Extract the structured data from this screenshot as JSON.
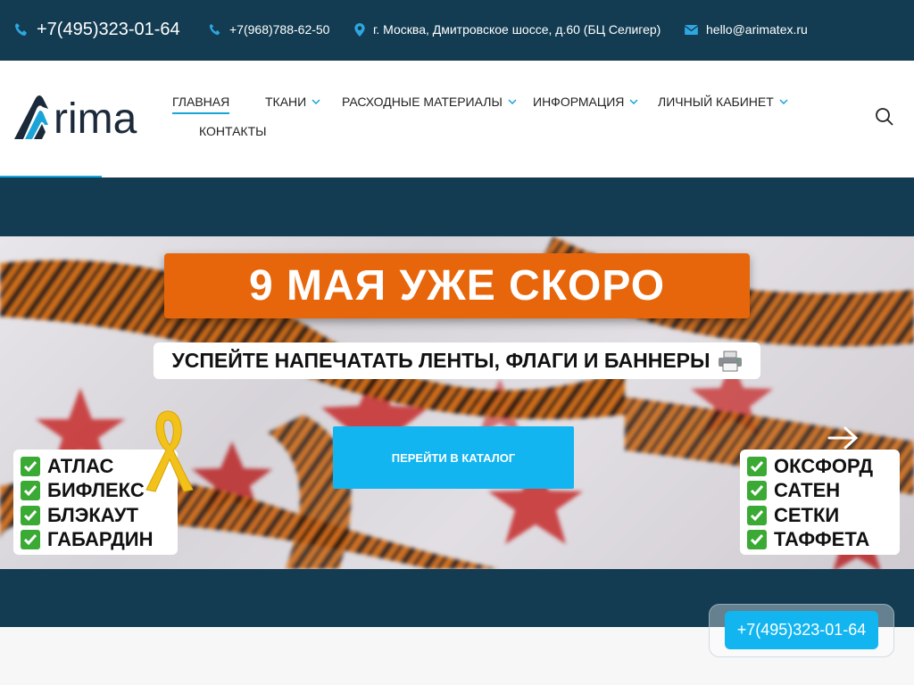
{
  "topbar": {
    "main_phone": "+7(495)323-01-64",
    "phone2": "+7(968)788-62-50",
    "address": "г. Москва, Дмитровское шоссе, д.60 (БЦ Селигер)",
    "email": "hello@arimatex.ru"
  },
  "logo": {
    "text": "rima"
  },
  "nav": {
    "home": "ГЛАВНАЯ",
    "fabrics": "ТКАНИ",
    "supplies": "РАСХОДНЫЕ МАТЕРИАЛЫ",
    "info": "ИНФОРМАЦИЯ",
    "account": "ЛИЧНЫЙ КАБИНЕТ",
    "contacts": "КОНТАКТЫ"
  },
  "hero": {
    "headline": "9 МАЯ УЖЕ СКОРО",
    "subline": "УСПЕЙТЕ НАПЕЧАТАТЬ ЛЕНТЫ, ФЛАГИ И БАННЕРЫ",
    "cta": "ПЕРЕЙТИ В КАТАЛОГ",
    "left_list": [
      "АТЛАС",
      "БИФЛЕКС",
      "БЛЭКАУТ",
      "ГАБАРДИН"
    ],
    "right_list": [
      "ОКСФОРД",
      "САТЕН",
      "СЕТКИ",
      "ТАФФЕТА"
    ]
  },
  "float_phone": "+7(495)323-01-64",
  "colors": {
    "dark": "#133c52",
    "accent": "#12b5f0",
    "orange": "#e8660b"
  },
  "icons": [
    "phone-icon",
    "location-icon",
    "mail-icon",
    "chevron-down-icon",
    "search-icon",
    "printer-icon",
    "check-icon",
    "arrow-right-icon",
    "ribbon-icon"
  ]
}
